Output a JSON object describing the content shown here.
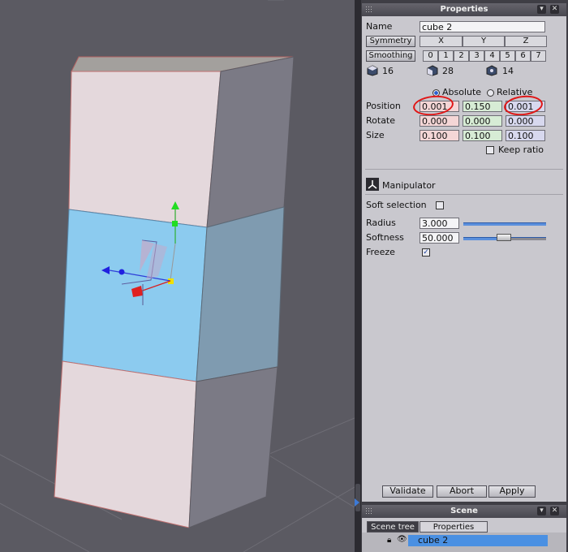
{
  "properties_panel": {
    "title": "Properties",
    "name_label": "Name",
    "name_value": "cube 2",
    "symmetry_label": "Symmetry",
    "symmetry_axes": [
      "X",
      "Y",
      "Z"
    ],
    "smoothing_label": "Smoothing",
    "smoothing_levels": [
      "0",
      "1",
      "2",
      "3",
      "4",
      "5",
      "6",
      "7"
    ],
    "stats": {
      "objects": "16",
      "faces": "28",
      "vertices": "14"
    },
    "mode_absolute": "Absolute",
    "mode_relative": "Relative",
    "position_label": "Position",
    "rotate_label": "Rotate",
    "size_label": "Size",
    "position": [
      "0.001",
      "0.150",
      "0.001"
    ],
    "rotate": [
      "0.000",
      "0.000",
      "0.000"
    ],
    "size": [
      "0.100",
      "0.100",
      "0.100"
    ],
    "keep_ratio_label": "Keep ratio",
    "manipulator_label": "Manipulator",
    "soft_selection_label": "Soft selection",
    "radius_label": "Radius",
    "radius_value": "3.000",
    "softness_label": "Softness",
    "softness_value": "50.000",
    "freeze_label": "Freeze",
    "validate_label": "Validate",
    "abort_label": "Abort",
    "apply_label": "Apply"
  },
  "scene_panel": {
    "title": "Scene",
    "tabs": [
      "Scene tree",
      "Properties"
    ],
    "items": [
      "cube 2"
    ]
  },
  "colors": {
    "selection": "#4a90e2",
    "face_highlight": "#8ccbef",
    "annotation": "#e01515"
  }
}
